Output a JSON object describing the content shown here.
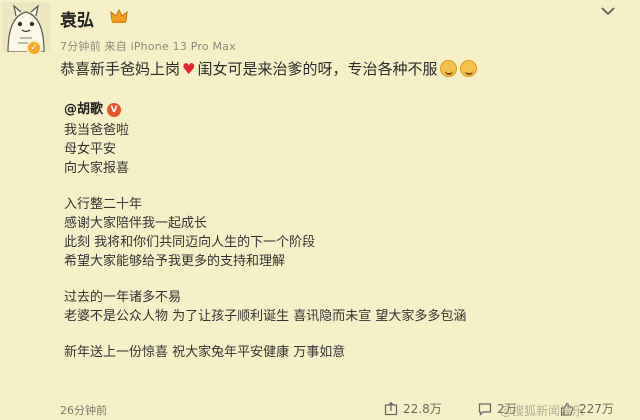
{
  "user": {
    "name": "袁弘",
    "meta": "7分钟前  来自 iPhone 13 Pro Max"
  },
  "post": {
    "lead_before_heart": "恭喜新手爸妈上岗",
    "lead_after_heart": "闺女可是来治爹的呀，专治各种不服"
  },
  "quote": {
    "mention": "@胡歌",
    "lines_a": [
      "我当爸爸啦",
      "母女平安",
      "向大家报喜"
    ],
    "lines_b": [
      "入行整二十年",
      "感谢大家陪伴我一起成长",
      "此刻 我将和你们共同迈向人生的下一个阶段",
      "希望大家能够给予我更多的支持和理解"
    ],
    "lines_c": [
      "过去的一年诸多不易",
      "老婆不是公众人物 为了让孩子顺利诞生 喜讯隐而未宣 望大家多多包涵"
    ],
    "lines_d": [
      "新年送上一份惊喜 祝大家兔年平安健康 万事如意"
    ]
  },
  "footer": {
    "time": "26分钟前",
    "share_count": "22.8万",
    "comment_count": "2万",
    "like_count": "227万"
  },
  "watermark": "@搜狐新闻娱乐",
  "colors": {
    "background": "#f5f0c8",
    "heart": "#e2222e",
    "verified_badge": "#f6a72a",
    "mention_badge": "#e8532a"
  }
}
